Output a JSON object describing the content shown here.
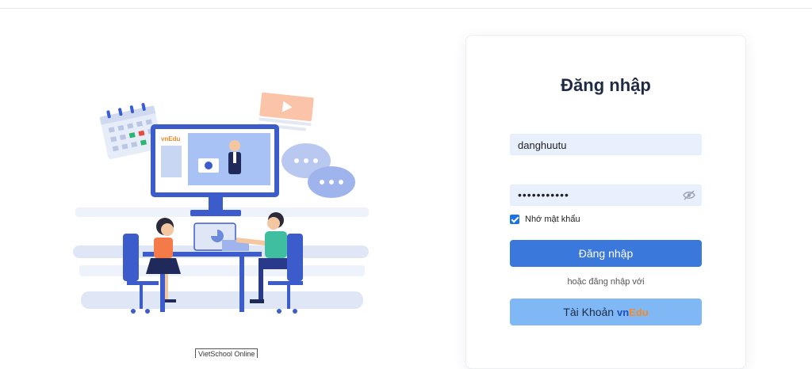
{
  "illustration": {
    "caption": "VietSchool Online",
    "screen_logo": "vnEdu"
  },
  "login": {
    "title": "Đăng nhập",
    "username_value": "danghuutu",
    "password_masked": "•••••••••••",
    "remember_label": "Nhớ mật khẩu",
    "remember_checked": true,
    "submit_label": "Đăng nhập",
    "alt_text": "hoặc đăng nhập với",
    "vnedu_button": {
      "prefix": "Tài Khoản",
      "brand_vn": "vn",
      "brand_edu": "Edu"
    }
  },
  "colors": {
    "primary": "#3b78dc",
    "secondary": "#7fb8f5",
    "field_bg": "#e8f0fe",
    "brand_orange": "#f28c28"
  },
  "icons": {
    "password_toggle": "eye-slash-icon",
    "checkbox": "check-icon"
  }
}
